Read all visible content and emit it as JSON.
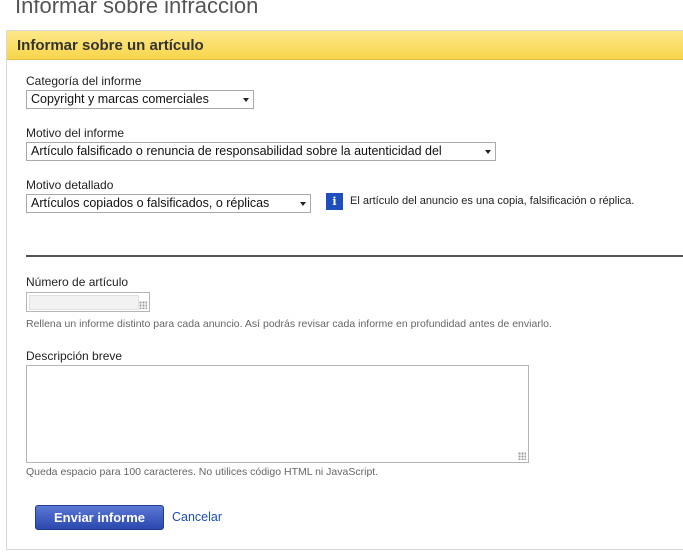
{
  "page": {
    "title": "Informar sobre infracción"
  },
  "panel": {
    "title": "Informar sobre un artículo"
  },
  "form": {
    "category": {
      "label": "Categoría del informe",
      "value": "Copyright y marcas comerciales"
    },
    "reason": {
      "label": "Motivo del informe",
      "value": "Artículo falsificado o renuncia de responsabilidad sobre la autenticidad del"
    },
    "detail": {
      "label": "Motivo detallado",
      "value": "Artículos copiados o falsificados, o réplicas"
    },
    "info": {
      "icon": "info-icon",
      "text": "El artículo del anuncio es una copia, falsificación o réplica."
    },
    "item_number": {
      "label": "Número de artículo",
      "value": "",
      "help": "Rellena un informe distinto para cada anuncio. Así podrás revisar cada informe en profundidad antes de enviarlo."
    },
    "description": {
      "label": "Descripción breve",
      "value": "",
      "help": "Queda espacio para 100 caracteres. No utilices código HTML ni JavaScript."
    }
  },
  "actions": {
    "submit_label": "Enviar informe",
    "cancel_label": "Cancelar"
  },
  "colors": {
    "header": "#f8d54a",
    "button": "#2a48ad",
    "link": "#1a4fb5"
  }
}
